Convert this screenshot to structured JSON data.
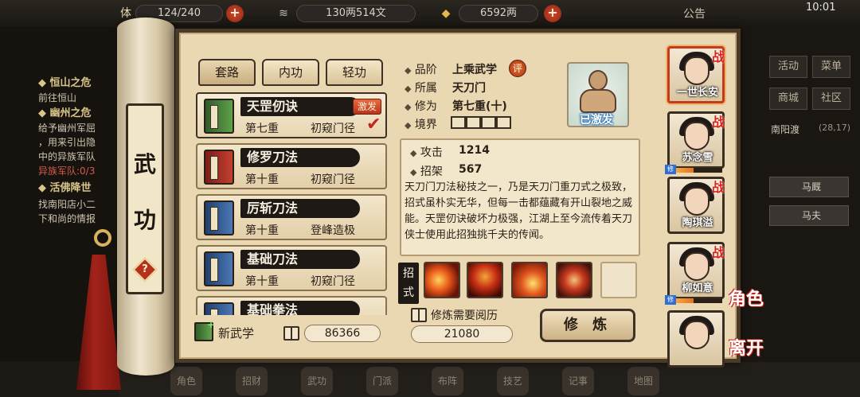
{
  "status_bar": {
    "stamina_label": "体力",
    "stamina": "124/240",
    "silver": "130两514文",
    "gold": "6592两",
    "notice": "公告",
    "time": "10:01"
  },
  "quests": [
    "◆ 恒山之危",
    "前往恒山",
    "◆ 幽州之危",
    "给予幽州军屈",
    "，用来引出隐",
    "中的异族军队",
    "异族军队:0/3",
    "◆ 活佛降世",
    "找南阳店小二",
    "下和尚的情报"
  ],
  "right_menu": {
    "buttons": [
      "活动",
      "菜单",
      "商城",
      "社区"
    ],
    "location": "南阳渡",
    "coords": "(28,17)",
    "rows": [
      "马厩",
      "马夫"
    ]
  },
  "scroll": {
    "title_1": "武",
    "title_2": "功",
    "help": "?"
  },
  "tabs": [
    "套路",
    "内功",
    "轻功"
  ],
  "skills": [
    {
      "name": "天罡仞诀",
      "level": "第七重",
      "rank": "初窥门径",
      "badge": "激发",
      "book": "green"
    },
    {
      "name": "修罗刀法",
      "level": "第十重",
      "rank": "初窥门径",
      "book": "red"
    },
    {
      "name": "厉斩刀法",
      "level": "第十重",
      "rank": "登峰造极",
      "book": "blue"
    },
    {
      "name": "基础刀法",
      "level": "第十重",
      "rank": "初窥门径",
      "book": "blue"
    },
    {
      "name": "基础拳法",
      "level": "",
      "rank": "",
      "book": "blue"
    }
  ],
  "footer": {
    "new_skill": "新武学",
    "experience": "86366",
    "train_cost_label": "修炼需要阅历",
    "train_cost": "21080",
    "train_button": "修 炼"
  },
  "detail": {
    "grade_label": "品阶",
    "grade": "上乘武学",
    "eval": "评",
    "belong_label": "所属",
    "belong": "天刀门",
    "cultivation_label": "修为",
    "cultivation": "第七重(十)",
    "realm_label": "境界",
    "attack_label": "攻击",
    "attack": "1214",
    "parry_label": "招架",
    "parry": "567",
    "description": "天刀门刀法秘技之一，乃是天刀门重刀式之极致，招式虽朴实无华，但每一击都蕴藏有开山裂地之威能。天罡仞诀破坏力极强，江湖上至今流传着天刀侠士使用此招独挑千夫的传闻。",
    "moves_label": "招式",
    "portrait_label": "已激发"
  },
  "characters": [
    {
      "name": "一世长安",
      "tag": "战"
    },
    {
      "name": "苏念雪",
      "tag": "战"
    },
    {
      "name": "陶琪溢",
      "tag": "战"
    },
    {
      "name": "柳如意",
      "tag": "战"
    },
    {
      "name": "",
      "tag": ""
    }
  ],
  "side_labels": {
    "role": "角色",
    "leave": "离开"
  },
  "bottom_icons": [
    "角色",
    "招财",
    "武功",
    "门派",
    "布阵",
    "技艺",
    "记事",
    "地图"
  ]
}
